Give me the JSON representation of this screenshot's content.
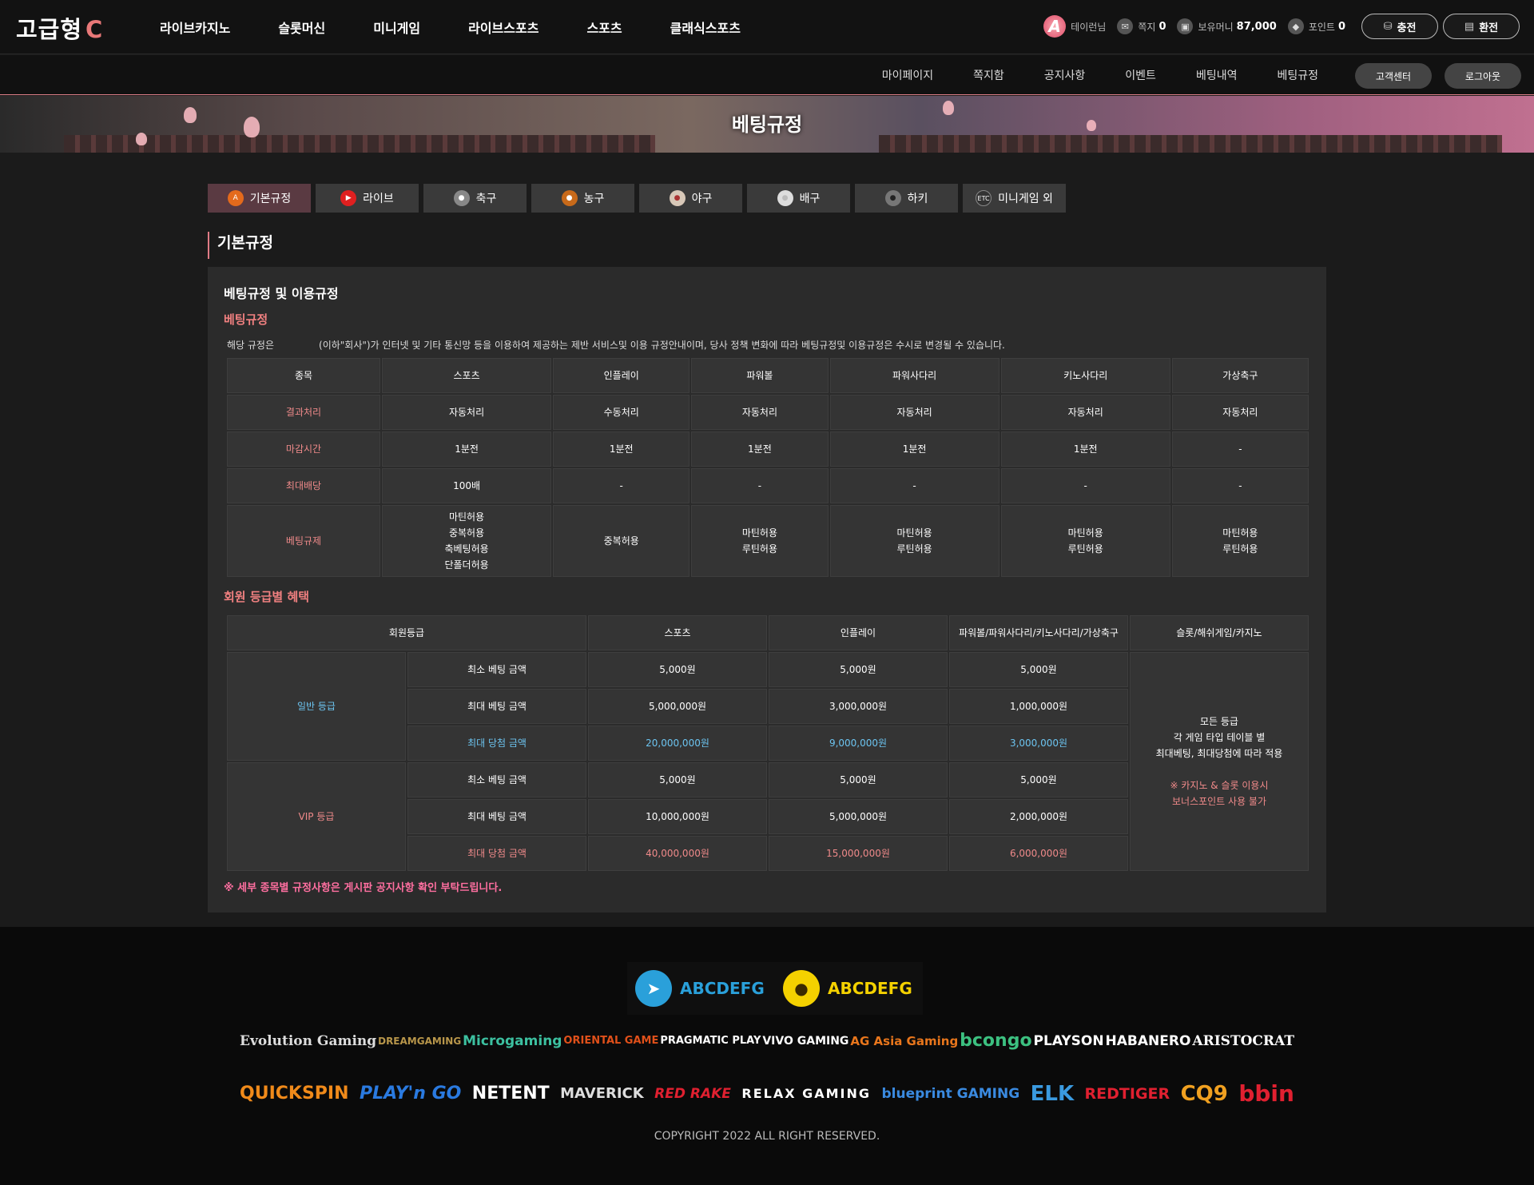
{
  "header": {
    "logo": "고급형",
    "logo_suffix": "C",
    "nav": [
      "라이브카지노",
      "슬롯머신",
      "미니게임",
      "라이브스포츠",
      "스포츠",
      "클래식스포츠"
    ],
    "avatar_letter": "A",
    "user_name": "테이런님",
    "msg_label": "쪽지",
    "msg_count": "0",
    "money_label": "보유머니",
    "money_value": "87,000",
    "point_label": "포인트",
    "point_value": "0",
    "deposit_label": "충전",
    "withdraw_label": "환전"
  },
  "subnav": {
    "items": [
      "마이페이지",
      "쪽지함",
      "공지사항",
      "이벤트",
      "베팅내역",
      "베팅규정"
    ],
    "support_label": "고객센터",
    "logout_label": "로그아웃"
  },
  "banner_title": "베팅규정",
  "tabs": [
    {
      "label": "기본규정",
      "icon": "A",
      "color": "#e46a1c"
    },
    {
      "label": "라이브",
      "icon": "▶",
      "color": "#e02020"
    },
    {
      "label": "축구",
      "icon": "●",
      "color": "#888888"
    },
    {
      "label": "농구",
      "icon": "●",
      "color": "#c86a1a"
    },
    {
      "label": "야구",
      "icon": "●",
      "color": "#d8c8b8"
    },
    {
      "label": "배구",
      "icon": "●",
      "color": "#dddddd"
    },
    {
      "label": "하키",
      "icon": "●",
      "color": "#777777"
    },
    {
      "label": "미니게임 외",
      "icon": "ETC",
      "color": "#333333"
    }
  ],
  "section_title": "기본규정",
  "panel": {
    "heading": "베팅규정 및 이용규정",
    "sub1": "베팅규정",
    "desc_prefix": "해당 규정은",
    "desc": "(이하\"회사\")가 인터넷 및 기타 통신망 등을 이용하여 제공하는 제반 서비스및 이용 규정안내이며, 당사 정책 변화에 따라 베팅규정및 이용규정은 수시로 변경될 수 있습니다.",
    "rules_table": {
      "headers": [
        "종목",
        "스포츠",
        "인플레이",
        "파워볼",
        "파워사다리",
        "키노사다리",
        "가상축구"
      ],
      "rows": [
        [
          "결과처리",
          "자동처리",
          "수동처리",
          "자동처리",
          "자동처리",
          "자동처리",
          "자동처리"
        ],
        [
          "마감시간",
          "1분전",
          "1분전",
          "1분전",
          "1분전",
          "1분전",
          "-"
        ],
        [
          "최대배당",
          "100배",
          "-",
          "-",
          "-",
          "-",
          "-"
        ]
      ],
      "restrict_label": "베팅규제",
      "restrict_sports": [
        "마틴허용",
        "중복허용",
        "축베팅허용",
        "단폴더허용"
      ],
      "restrict_inplay": "중복허용",
      "restrict_other": [
        "마틴허용",
        "루틴허용"
      ]
    },
    "sub2": "회원 등급별 혜택",
    "grade_table": {
      "headers": [
        "회원등급",
        "스포츠",
        "인플레이",
        "파워볼/파워사다리/키노사다리/가상축구",
        "슬롯/해쉬게임/카지노"
      ],
      "general_label": "일반 등급",
      "vip_label": "VIP 등급",
      "row_labels": [
        "최소 베팅 금액",
        "최대 베팅 금액",
        "최대 당첨 금액"
      ],
      "general": [
        [
          "5,000원",
          "5,000원",
          "5,000원"
        ],
        [
          "5,000,000원",
          "3,000,000원",
          "1,000,000원"
        ],
        [
          "20,000,000원",
          "9,000,000원",
          "3,000,000원"
        ]
      ],
      "vip": [
        [
          "5,000원",
          "5,000원",
          "5,000원"
        ],
        [
          "10,000,000원",
          "5,000,000원",
          "2,000,000원"
        ],
        [
          "40,000,000원",
          "15,000,000원",
          "6,000,000원"
        ]
      ],
      "casino_note": [
        "모든 등급",
        "각 게임 타입 테이블 별",
        "최대베팅, 최대당첨에 따라 적용"
      ],
      "casino_warn": [
        "※ 카지노 & 슬롯 이용시",
        "보너스포인트 사용 불가"
      ]
    },
    "footnote": "※ 세부 종목별 규정사항은 게시판 공지사항 확인 부탁드립니다."
  },
  "footer": {
    "telegram": "ABCDEFG",
    "kakao": "ABCDEFG",
    "brands_row1": [
      {
        "name": "Evolution Gaming",
        "color": "#dddddd"
      },
      {
        "name": "DREAMGAMING",
        "color": "#b8964a"
      },
      {
        "name": "Microgaming",
        "color": "#3cc0a0"
      },
      {
        "name": "ORIENTAL GAME",
        "color": "#e0501a"
      },
      {
        "name": "PRAGMATIC PLAY",
        "color": "#ffffff"
      },
      {
        "name": "VIVO GAMING",
        "color": "#ffffff"
      },
      {
        "name": "AG Asia Gaming",
        "color": "#e8761c"
      },
      {
        "name": "bcongo",
        "color": "#3cc080"
      },
      {
        "name": "PLAYSON",
        "color": "#ffffff"
      },
      {
        "name": "HABANERO",
        "color": "#ffffff"
      },
      {
        "name": "ARISTOCRAT",
        "color": "#ffffff"
      }
    ],
    "brands_row2": [
      {
        "name": "QUICKSPIN",
        "color": "#f08a1a"
      },
      {
        "name": "PLAY'n GO",
        "color": "#2a7ae0"
      },
      {
        "name": "NETENT",
        "color": "#ffffff"
      },
      {
        "name": "MAVERICK",
        "color": "#dddddd"
      },
      {
        "name": "RED RAKE",
        "color": "#e02030"
      },
      {
        "name": "RELAX GAMING",
        "color": "#ffffff"
      },
      {
        "name": "blueprint GAMING",
        "color": "#3a8ae0"
      },
      {
        "name": "ELK",
        "color": "#3a9ae0"
      },
      {
        "name": "REDTIGER",
        "color": "#e02030"
      },
      {
        "name": "CQ9",
        "color": "#f0a020"
      },
      {
        "name": "bbin",
        "color": "#e02030"
      }
    ],
    "copyright": "COPYRIGHT 2022  ALL RIGHT RESERVED."
  }
}
